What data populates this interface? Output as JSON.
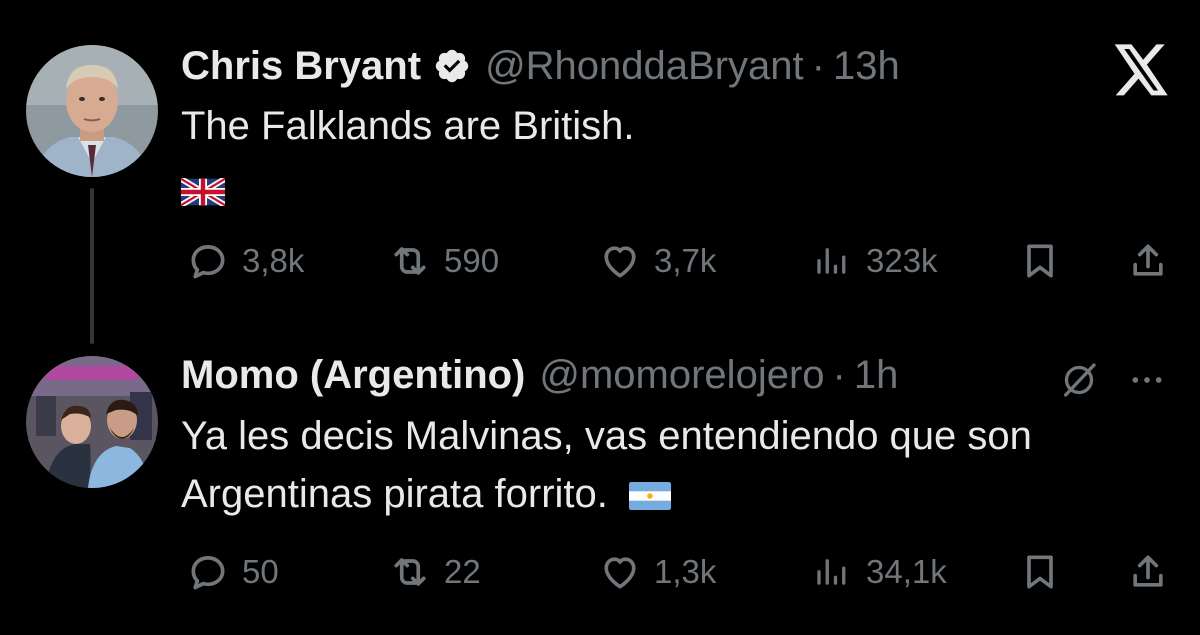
{
  "colors": {
    "background": "#000000",
    "text": "#e7e9ea",
    "muted": "#71767b",
    "verified": "#e7e9ea",
    "thread_line": "#333639"
  },
  "tweets": [
    {
      "author_name": "Chris Bryant",
      "handle": "@RhonddaBryant",
      "separator": "·",
      "time": "13h",
      "verified": true,
      "text": "The Falklands are British.",
      "flag": "uk-flag-icon",
      "actions": {
        "replies": "3,8k",
        "reposts": "590",
        "likes": "3,7k",
        "views": "323k"
      }
    },
    {
      "author_name": "Momo (Argentino)",
      "handle": "@momorelojero",
      "separator": "·",
      "time": "1h",
      "verified": false,
      "text_line1": "Ya les decis Malvinas, vas entendiendo que son",
      "text_line2": "Argentinas pirata forrito.",
      "flag": "argentina-flag-icon",
      "actions": {
        "replies": "50",
        "reposts": "22",
        "likes": "1,3k",
        "views": "34,1k"
      }
    }
  ],
  "icons": [
    "reply-icon",
    "repost-icon",
    "like-icon",
    "views-icon",
    "bookmark-icon",
    "share-icon",
    "x-logo-icon",
    "grok-icon",
    "more-options-icon"
  ]
}
